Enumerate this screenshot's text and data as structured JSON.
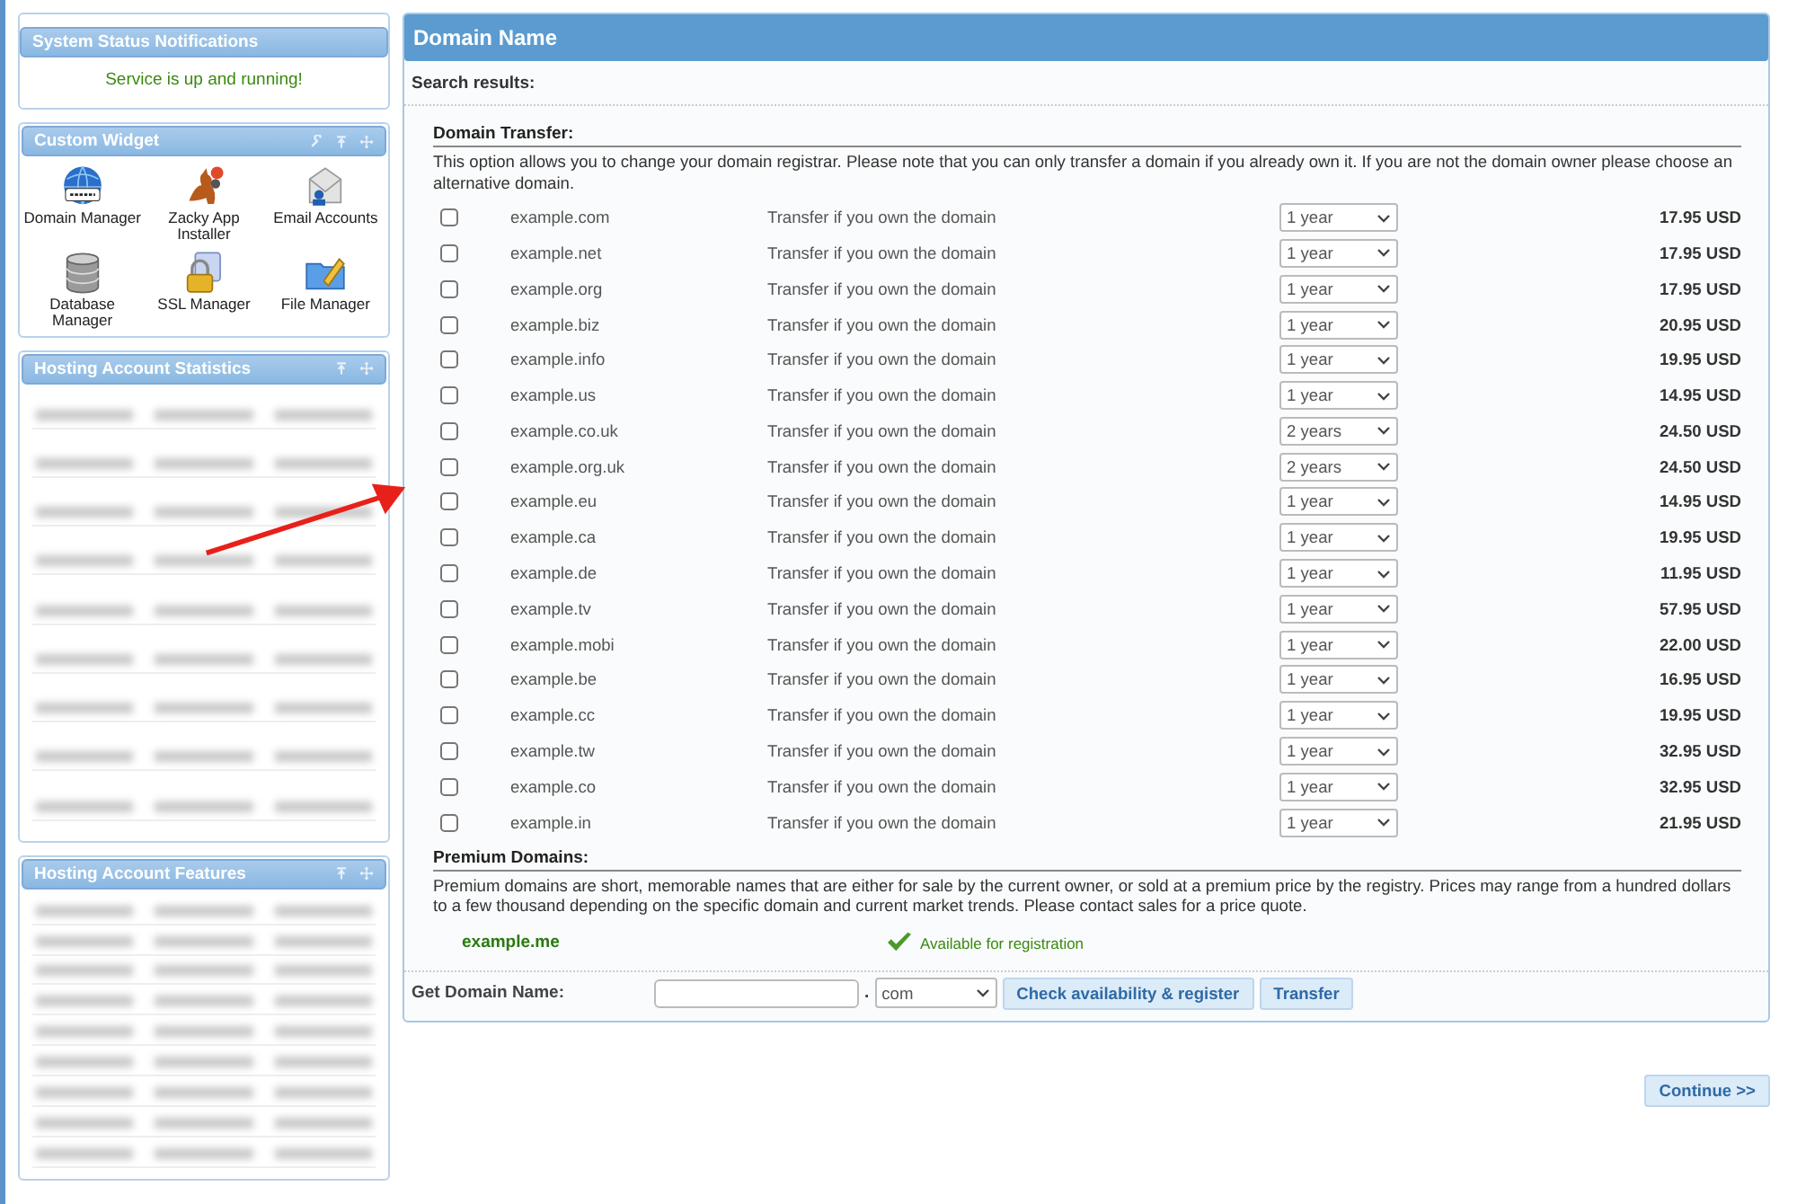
{
  "sidebar": {
    "widgets": [
      {
        "kind": "status",
        "title": "System Status Notifications",
        "message": "Service is up and running!"
      },
      {
        "kind": "icons",
        "title": "Custom Widget",
        "items": [
          {
            "kind": "globe",
            "label": "Domain Manager"
          },
          {
            "kind": "installer",
            "label": "Zacky App Installer"
          },
          {
            "kind": "envelope",
            "label": "Email Accounts"
          },
          {
            "kind": "database",
            "label": "Database Manager"
          },
          {
            "kind": "padlock",
            "label": "SSL Manager"
          },
          {
            "kind": "folder",
            "label": "File Manager"
          }
        ]
      },
      {
        "kind": "blurred",
        "title": "Hosting Account Statistics"
      },
      {
        "kind": "blurred",
        "title": "Hosting Account Features"
      }
    ]
  },
  "main": {
    "title": "Domain Name",
    "search_label": "Search results:",
    "transfer": {
      "heading": "Domain Transfer:",
      "description": "This option allows you to change your domain registrar. Please note that you can only transfer a domain if you already own it. If you are not the domain owner please choose an alternative domain.",
      "rows": [
        {
          "domain": "example.com",
          "action": "Transfer if you own the domain",
          "period": "1 year",
          "price": "17.95 USD",
          "checked": false
        },
        {
          "domain": "example.net",
          "action": "Transfer if you own the domain",
          "period": "1 year",
          "price": "17.95 USD",
          "checked": false
        },
        {
          "domain": "example.org",
          "action": "Transfer if you own the domain",
          "period": "1 year",
          "price": "17.95 USD",
          "checked": false
        },
        {
          "domain": "example.biz",
          "action": "Transfer if you own the domain",
          "period": "1 year",
          "price": "20.95 USD",
          "checked": false
        },
        {
          "domain": "example.info",
          "action": "Transfer if you own the domain",
          "period": "1 year",
          "price": "19.95 USD",
          "checked": false
        },
        {
          "domain": "example.us",
          "action": "Transfer if you own the domain",
          "period": "1 year",
          "price": "14.95 USD",
          "checked": false
        },
        {
          "domain": "example.co.uk",
          "action": "Transfer if you own the domain",
          "period": "2 years",
          "price": "24.50 USD",
          "checked": false
        },
        {
          "domain": "example.org.uk",
          "action": "Transfer if you own the domain",
          "period": "2 years",
          "price": "24.50 USD",
          "checked": false
        },
        {
          "domain": "example.eu",
          "action": "Transfer if you own the domain",
          "period": "1 year",
          "price": "14.95 USD",
          "checked": false
        },
        {
          "domain": "example.ca",
          "action": "Transfer if you own the domain",
          "period": "1 year",
          "price": "19.95 USD",
          "checked": false
        },
        {
          "domain": "example.de",
          "action": "Transfer if you own the domain",
          "period": "1 year",
          "price": "11.95 USD",
          "checked": false
        },
        {
          "domain": "example.tv",
          "action": "Transfer if you own the domain",
          "period": "1 year",
          "price": "57.95 USD",
          "checked": false
        },
        {
          "domain": "example.mobi",
          "action": "Transfer if you own the domain",
          "period": "1 year",
          "price": "22.00 USD",
          "checked": false
        },
        {
          "domain": "example.be",
          "action": "Transfer if you own the domain",
          "period": "1 year",
          "price": "16.95 USD",
          "checked": false
        },
        {
          "domain": "example.cc",
          "action": "Transfer if you own the domain",
          "period": "1 year",
          "price": "19.95 USD",
          "checked": false
        },
        {
          "domain": "example.tw",
          "action": "Transfer if you own the domain",
          "period": "1 year",
          "price": "32.95 USD",
          "checked": false
        },
        {
          "domain": "example.co",
          "action": "Transfer if you own the domain",
          "period": "1 year",
          "price": "32.95 USD",
          "checked": false
        },
        {
          "domain": "example.in",
          "action": "Transfer if you own the domain",
          "period": "1 year",
          "price": "21.95 USD",
          "checked": false
        }
      ]
    },
    "premium": {
      "heading": "Premium Domains:",
      "description": "Premium domains are short, memorable names that are either for sale by the current owner, or sold at a premium price by the registry. Prices may range from a hundred dollars to a few thousand depending on the specific domain and current market trends. Please contact sales for a price quote.",
      "domain": "example.me",
      "status": "Available for registration"
    },
    "get_domain": {
      "label": "Get Domain Name:",
      "dot": ".",
      "tld": "com",
      "buttons": [
        "Check availability & register",
        "Transfer"
      ]
    },
    "continue_button": "Continue >>"
  }
}
